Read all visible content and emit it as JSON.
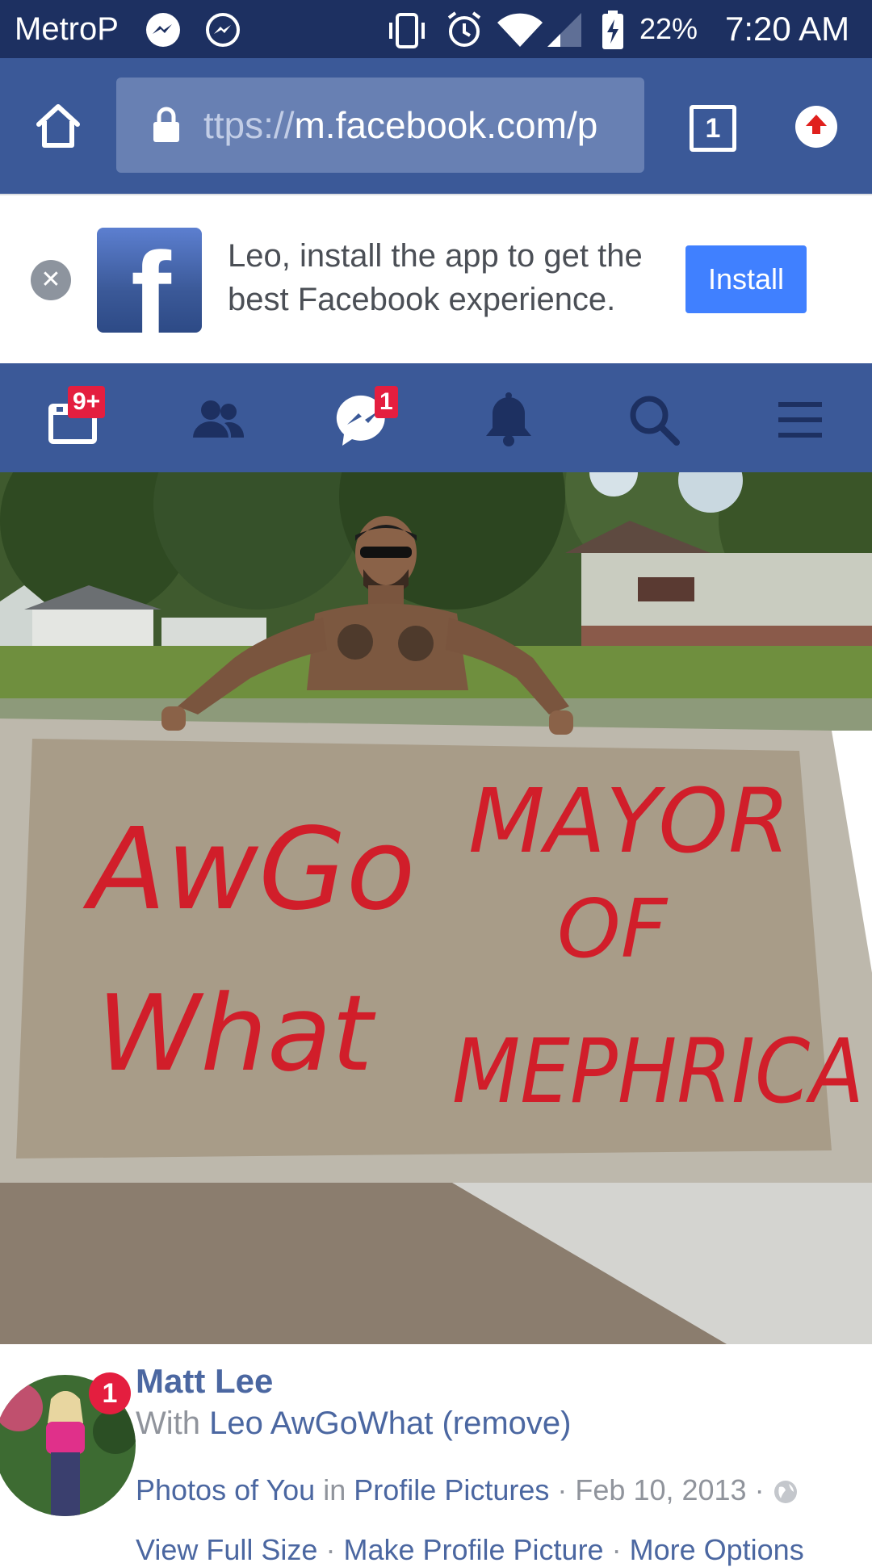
{
  "status_bar": {
    "carrier": "MetroP",
    "battery": "22%",
    "time": "7:20 AM"
  },
  "browser": {
    "url_prefix": "ttps://",
    "url_main": "m.facebook.com/p",
    "tab_count": "1"
  },
  "banner": {
    "message": "Leo, install the app to get the best Facebook experience.",
    "install_label": "Install",
    "logo_letter": "f"
  },
  "nav": {
    "feed_badge": "9+",
    "messages_badge": "1"
  },
  "photo": {
    "sign_left_line1": "AwGo",
    "sign_left_line2": "What",
    "sign_right_line1": "MAYOR",
    "sign_right_line2": "OF",
    "sign_right_line3": "MEPHRICA"
  },
  "post": {
    "avatar_badge": "1",
    "author": "Matt Lee",
    "with_prefix": "With",
    "tagged_user": "Leo AwGoWhat",
    "remove_label": "(remove)",
    "album_owner": "Photos of You",
    "in_word": "in",
    "album_name": "Profile Pictures",
    "sep": "·",
    "date": "Feb 10, 2013",
    "action_full_size": "View Full Size",
    "action_profile_picture": "Make Profile Picture",
    "action_more": "More Options"
  },
  "colors": {
    "fb_blue": "#3b5998",
    "status_bar": "#1d3061",
    "install_blue": "#4080ff",
    "badge_red": "#e41e3f",
    "link": "#4b67a1"
  }
}
